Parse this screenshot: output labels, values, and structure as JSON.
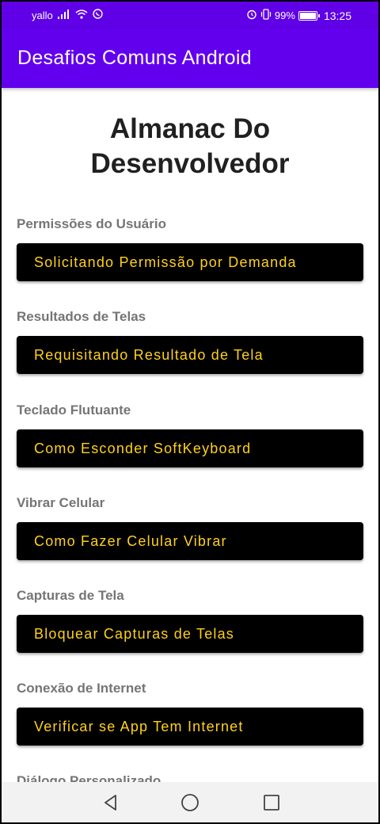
{
  "status_bar": {
    "carrier": "yallo",
    "battery_text": "99%",
    "battery_level": 0.99,
    "time": "13:25",
    "icons": [
      "signal-icon",
      "wifi-icon",
      "whatsapp-icon",
      "alarm-icon",
      "vibrate-icon",
      "battery-icon"
    ]
  },
  "app_bar": {
    "title": "Desafios Comuns Android",
    "color": "#6200ee"
  },
  "main": {
    "title": "Almanac Do Desenvolvedor",
    "sections": [
      {
        "label": "Permissões do Usuário",
        "button": "Solicitando Permissão por Demanda"
      },
      {
        "label": "Resultados de Telas",
        "button": "Requisitando Resultado de Tela"
      },
      {
        "label": "Teclado Flutuante",
        "button": "Como Esconder SoftKeyboard"
      },
      {
        "label": "Vibrar Celular",
        "button": "Como Fazer Celular Vibrar"
      },
      {
        "label": "Capturas de Tela",
        "button": "Bloquear Capturas de Telas"
      },
      {
        "label": "Conexão de Internet",
        "button": "Verificar se App Tem Internet"
      },
      {
        "label": "Diálogo Personalizado"
      }
    ]
  },
  "colors": {
    "button_bg": "#000000",
    "button_text": "#ffd11a",
    "section_label": "#757575"
  },
  "nav_bar": {
    "icons": [
      "back-icon",
      "home-icon",
      "recents-icon"
    ]
  }
}
